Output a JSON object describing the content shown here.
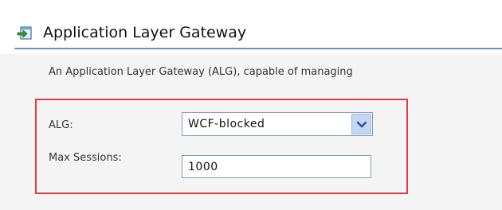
{
  "section": {
    "title": "Application Layer Gateway",
    "icon": "arrow-into-box-icon",
    "description": "An Application Layer Gateway (ALG), capable of managing"
  },
  "form": {
    "alg": {
      "label": "ALG:",
      "value": "WCF-blocked",
      "icon": "chevron-down-icon"
    },
    "max_sessions": {
      "label": "Max Sessions:",
      "value": "1000"
    }
  },
  "colors": {
    "highlight_border": "#e13b3b",
    "header_rule": "#6d8fb8",
    "panel_background": "#f4f4f4",
    "dropdown_button": "#c5d5f2"
  }
}
